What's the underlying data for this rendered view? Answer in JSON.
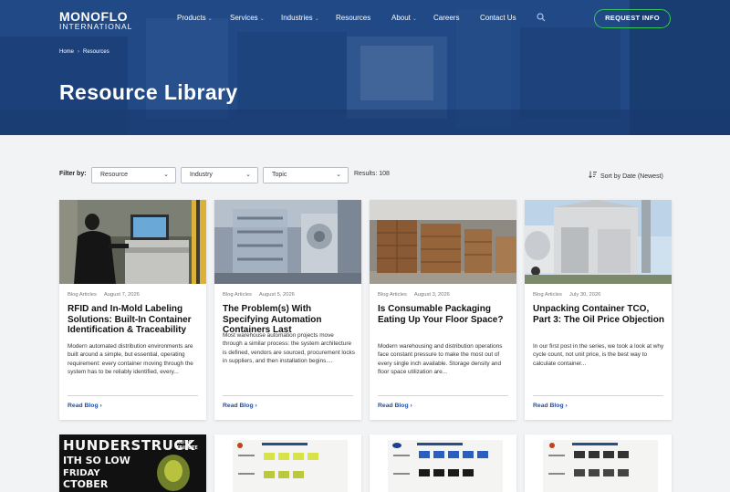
{
  "brand": {
    "name": "MONOFLO",
    "sub": "INTERNATIONAL"
  },
  "nav": {
    "items": [
      {
        "label": "Products",
        "dropdown": true
      },
      {
        "label": "Services",
        "dropdown": true
      },
      {
        "label": "Industries",
        "dropdown": true
      },
      {
        "label": "Resources",
        "dropdown": false
      },
      {
        "label": "About",
        "dropdown": true
      },
      {
        "label": "Careers",
        "dropdown": false
      },
      {
        "label": "Contact Us",
        "dropdown": false
      }
    ],
    "search_icon": "search-icon",
    "cta": "REQUEST INFO"
  },
  "breadcrumb": {
    "home": "Home",
    "current": "Resources"
  },
  "page_title": "Resource Library",
  "filters": {
    "label": "Filter by:",
    "selects": [
      {
        "value": "Resource"
      },
      {
        "value": "Industry"
      },
      {
        "value": "Topic"
      }
    ],
    "results": "Results: 108",
    "sort": "Sort by Date (Newest)"
  },
  "colors": {
    "brand_blue": "#1f4fa3",
    "hero_blue": "#234c8c",
    "cta_green": "#35c759"
  },
  "cards": [
    {
      "category": "Blog Articles",
      "date": "August 7, 2026",
      "title": "RFID and In-Mold Labeling Solutions: Built-In Container Identification & Traceability",
      "excerpt": "Modern automated distribution environments are built around a simple, but essential, operating requirement: every container moving through the system has to be reliably identified, every...",
      "cta": "Read Blog ›"
    },
    {
      "category": "Blog Articles",
      "date": "August 5, 2026",
      "title": "The Problem(s) With Specifying Automation Containers Last",
      "excerpt": "Most warehouse automation projects move through a similar process: the system architecture is defined, vendors are sourced, procurement locks in suppliers, and then installation begins....",
      "cta": "Read Blog ›"
    },
    {
      "category": "Blog Articles",
      "date": "August 3, 2026",
      "title": "Is Consumable Packaging Eating Up Your Floor Space?",
      "excerpt": "Modern warehousing and distribution operations face constant pressure to make the most out of every single inch available. Storage density and floor space utilization are...",
      "cta": "Read Blog ›"
    },
    {
      "category": "Blog Articles",
      "date": "July 30, 2026",
      "title": "Unpacking Container TCO, Part 3: The Oil Price Objection",
      "excerpt": "In our first post in the series, we took a look at why cycle count, not unit price, is the best way to calculate container...",
      "cta": "Read Blog ›"
    }
  ],
  "poster": {
    "line1": "HUNDERSTRUCK",
    "line2": "ITH SO LOW",
    "line3": "FRIDAY",
    "line4": "CTOBER",
    "tag": "AC/DC TRIBUTE"
  }
}
